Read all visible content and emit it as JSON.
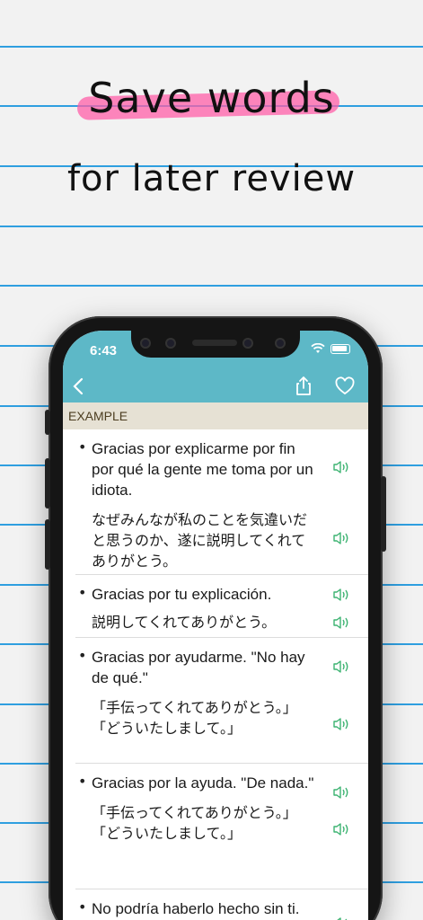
{
  "headline": {
    "line1": "Save words",
    "line2": "for later review"
  },
  "status": {
    "time": "6:43"
  },
  "nav": {
    "back_icon": "chevron-left-icon",
    "share_icon": "share-icon",
    "favorite_icon": "heart-icon"
  },
  "section": {
    "title": "EXAMPLE"
  },
  "examples": [
    {
      "es": "Gracias por explicarme por fin por qué la gente me toma por un idiota.",
      "ja": "なぜみんなが私のことを気違いだと思うのか、遂に説明してくれてありがとう。"
    },
    {
      "es": "Gracias por tu explicación.",
      "ja": "説明してくれてありがとう。"
    },
    {
      "es": "Gracias por ayudarme. \"No hay de qué.\"",
      "ja": "「手伝ってくれてありがとう。」 「どういたしまして。」"
    },
    {
      "es": "Gracias por la ayuda. \"De nada.\"",
      "ja": "「手伝ってくれてありがとう。」 「どういたしまして。」"
    },
    {
      "es": "No podría haberlo hecho sin ti.",
      "ja": ""
    }
  ],
  "colors": {
    "accent_bar": "#5db8c7",
    "section_bg": "#e6e1d4",
    "speaker_icon": "#3cb371",
    "ruled_line": "#2f9fe0",
    "highlight": "#ff5fa8"
  }
}
